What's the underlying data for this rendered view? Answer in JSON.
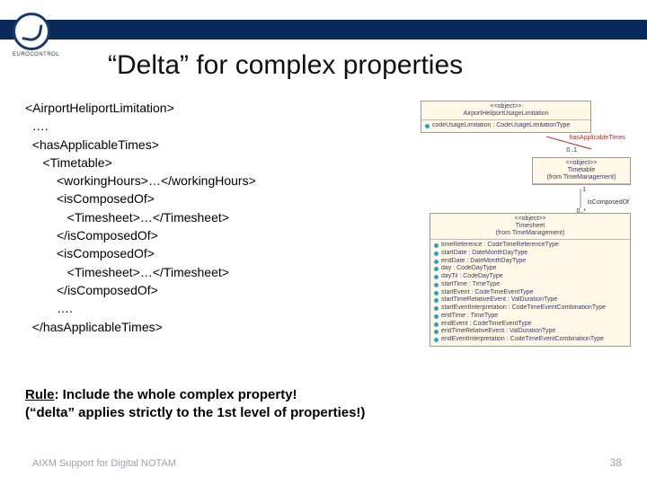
{
  "logo_text": "EUROCONTROL",
  "title": "“Delta” for complex properties",
  "code_lines": [
    "<AirportHeliportLimitation>",
    "  ….",
    "  <hasApplicableTimes>",
    "     <Timetable>",
    "         <workingHours>…</workingHours>",
    "         <isComposedOf>",
    "            <Timesheet>…</Timesheet>",
    "         </isComposedOf>",
    "         <isComposedOf>",
    "            <Timesheet>…</Timesheet>",
    "         </isComposedOf>",
    "         ….",
    "  </hasApplicableTimes>"
  ],
  "rule_line1_prefix": "Rule",
  "rule_line1_rest": ": Include the whole complex property!",
  "rule_line2": "(“delta” applies strictly to the 1st level of properties!)",
  "footer_left": "AIXM Support for Digital NOTAM",
  "footer_right": "38",
  "diagram": {
    "box1": {
      "stereo": "<<object>>",
      "name": "AirportHeliportUsageLimitation",
      "attr": "codeUsageLimitation : CodeUsageLimitationType"
    },
    "assoc1": {
      "name": "hasApplicableTimes",
      "mult": "0..1"
    },
    "box2": {
      "stereo": "<<object>>",
      "name": "Timetable",
      "from": "(from TimeManagement)"
    },
    "assoc2": {
      "name": "isComposedOf",
      "mult_top": "1",
      "mult_bot": "0..*"
    },
    "box3": {
      "stereo": "<<object>>",
      "name": "Timesheet",
      "from": "(from TimeManagement)",
      "attrs": [
        "timeReference : CodeTimeReferenceType",
        "startDate : DateMonthDayType",
        "endDate : DateMonthDayType",
        "day : CodeDayType",
        "dayTil : CodeDayType",
        "startTime : TimeType",
        "startEvent : CodeTimeEventType",
        "startTimeRelativeEvent : ValDurationType",
        "startEventInterpretation : CodeTimeEventCombinationType",
        "endTime : TimeType",
        "endEvent : CodeTimeEventType",
        "endTimeRelativeEvent : ValDurationType",
        "endEventInterpretation : CodeTimeEventCombinationType"
      ]
    }
  }
}
